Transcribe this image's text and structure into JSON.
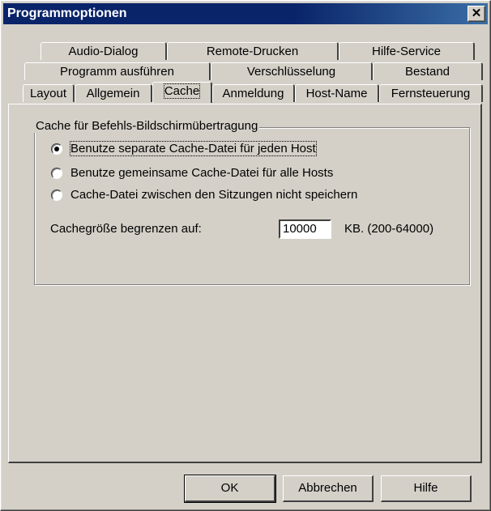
{
  "window": {
    "title": "Programmoptionen",
    "close_glyph": "✕"
  },
  "tabs": {
    "row1": [
      "Audio-Dialog",
      "Remote-Drucken",
      "Hilfe-Service"
    ],
    "row2": [
      "Programm ausführen",
      "Verschlüsselung",
      "Bestand"
    ],
    "row3": [
      "Layout",
      "Allgemein",
      "Cache",
      "Anmeldung",
      "Host-Name",
      "Fernsteuerung"
    ],
    "active": "Cache"
  },
  "cache": {
    "group_label": "Cache für Befehls-Bildschirmübertragung",
    "options": [
      {
        "label": "Benutze separate Cache-Datei für jeden Host",
        "selected": true
      },
      {
        "label": "Benutze gemeinsame Cache-Datei für alle Hosts",
        "selected": false
      },
      {
        "label": "Cache-Datei zwischen den Sitzungen nicht speichern",
        "selected": false
      }
    ],
    "size_label": "Cachegröße begrenzen auf:",
    "size_value": "10000",
    "size_unit": "KB. (200-64000)"
  },
  "buttons": {
    "ok": "OK",
    "cancel": "Abbrechen",
    "help": "Hilfe"
  },
  "colors": {
    "title_bar": "#0a246a",
    "face": "#d4d0c8"
  }
}
